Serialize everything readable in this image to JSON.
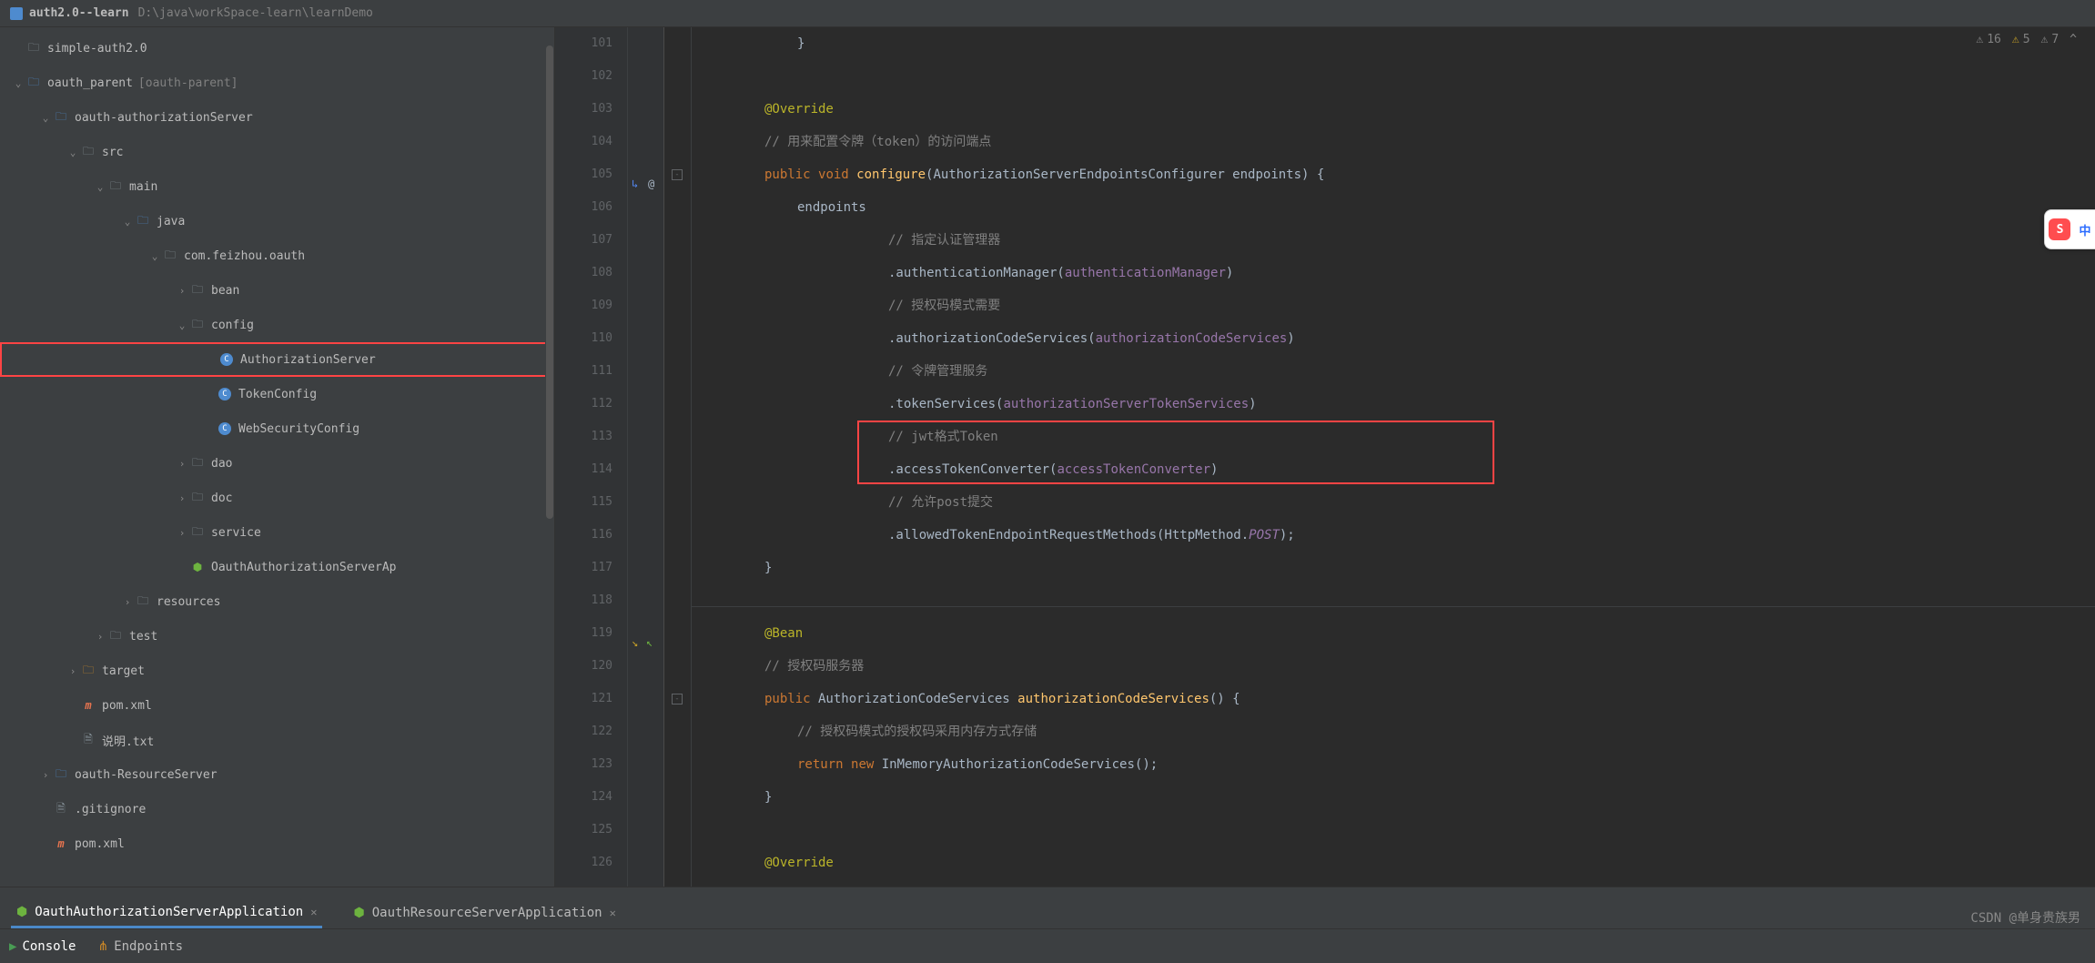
{
  "breadcrumb": {
    "project": "auth2.0--learn",
    "path": "D:\\java\\workSpace-learn\\learnDemo"
  },
  "tree": {
    "items": [
      {
        "indent": 0,
        "arrow": "none",
        "icon": "folder",
        "label": "simple-auth2.0"
      },
      {
        "indent": 0,
        "arrow": "open",
        "icon": "folder-blue",
        "label": "oauth_parent",
        "suffix": "[oauth-parent]"
      },
      {
        "indent": 1,
        "arrow": "open",
        "icon": "folder-blue",
        "label": "oauth-authorizationServer"
      },
      {
        "indent": 2,
        "arrow": "open",
        "icon": "folder",
        "label": "src"
      },
      {
        "indent": 3,
        "arrow": "open",
        "icon": "folder",
        "label": "main"
      },
      {
        "indent": 4,
        "arrow": "open",
        "icon": "folder-blue",
        "label": "java"
      },
      {
        "indent": 5,
        "arrow": "open",
        "icon": "folder",
        "label": "com.feizhou.oauth"
      },
      {
        "indent": 6,
        "arrow": "closed",
        "icon": "folder",
        "label": "bean"
      },
      {
        "indent": 6,
        "arrow": "open",
        "icon": "folder",
        "label": "config"
      },
      {
        "indent": 7,
        "arrow": "none",
        "icon": "class",
        "label": "AuthorizationServer",
        "selected": true
      },
      {
        "indent": 7,
        "arrow": "none",
        "icon": "class",
        "label": "TokenConfig"
      },
      {
        "indent": 7,
        "arrow": "none",
        "icon": "class",
        "label": "WebSecurityConfig"
      },
      {
        "indent": 6,
        "arrow": "closed",
        "icon": "folder",
        "label": "dao"
      },
      {
        "indent": 6,
        "arrow": "closed",
        "icon": "folder",
        "label": "doc"
      },
      {
        "indent": 6,
        "arrow": "closed",
        "icon": "folder",
        "label": "service"
      },
      {
        "indent": 6,
        "arrow": "none",
        "icon": "spring",
        "label": "OauthAuthorizationServerAp"
      },
      {
        "indent": 4,
        "arrow": "closed",
        "icon": "folder",
        "iconClass": "folder",
        "label": "resources"
      },
      {
        "indent": 3,
        "arrow": "closed",
        "icon": "folder",
        "label": "test"
      },
      {
        "indent": 2,
        "arrow": "closed",
        "icon": "folder-orange",
        "label": "target"
      },
      {
        "indent": 2,
        "arrow": "none",
        "icon": "mvn",
        "label": "pom.xml"
      },
      {
        "indent": 2,
        "arrow": "none",
        "icon": "file",
        "label": "说明.txt"
      },
      {
        "indent": 1,
        "arrow": "closed",
        "icon": "folder-blue",
        "label": "oauth-ResourceServer"
      },
      {
        "indent": 1,
        "arrow": "none",
        "icon": "file",
        "label": ".gitignore"
      },
      {
        "indent": 1,
        "arrow": "none",
        "icon": "mvn",
        "label": "pom.xml"
      }
    ]
  },
  "editor_hints": {
    "errors": "16",
    "warnings": "5",
    "weak": "7"
  },
  "gutter_marks": {
    "105": "override",
    "119": "impl-pair"
  },
  "code_lines": [
    {
      "n": 101,
      "html": "<span class='indent2'></span>}"
    },
    {
      "n": 102,
      "html": ""
    },
    {
      "n": 103,
      "html": "<span class='indent1'></span><span class='hl-annotation'>@Override</span>"
    },
    {
      "n": 104,
      "html": "<span class='indent1'></span><span class='hl-comment'>// 用来配置令牌（token）的访问端点</span>"
    },
    {
      "n": 105,
      "html": "<span class='indent1'></span><span class='hl-keyword'>public</span> <span class='hl-keyword'>void</span> <span class='hl-method'>configure</span>(AuthorizationServerEndpointsConfigurer endpoints) {"
    },
    {
      "n": 106,
      "html": "<span class='indent2'></span>endpoints"
    },
    {
      "n": 107,
      "html": "<span class='indent3'></span><span class='hl-comment'>// 指定认证管理器</span>"
    },
    {
      "n": 108,
      "html": "<span class='indent3'></span>.authenticationManager(<span class='hl-field'>authenticationManager</span>)"
    },
    {
      "n": 109,
      "html": "<span class='indent3'></span><span class='hl-comment'>// 授权码模式需要</span>"
    },
    {
      "n": 110,
      "html": "<span class='indent3'></span>.authorizationCodeServices(<span class='hl-field'>authorizationCodeServices</span>)"
    },
    {
      "n": 111,
      "html": "<span class='indent3'></span><span class='hl-comment'>// 令牌管理服务</span>"
    },
    {
      "n": 112,
      "html": "<span class='indent3'></span>.tokenServices(<span class='hl-field'>authorizationServerTokenServices</span>)"
    },
    {
      "n": 113,
      "html": "<span class='indent3'></span><span class='hl-comment'>// jwt格式Token</span>"
    },
    {
      "n": 114,
      "html": "<span class='indent3'></span>.accessTokenConverter(<span class='hl-field'>accessTokenConverter</span>)"
    },
    {
      "n": 115,
      "html": "<span class='indent3'></span><span class='hl-comment'>// 允许post提交</span>"
    },
    {
      "n": 116,
      "html": "<span class='indent3'></span>.allowedTokenEndpointRequestMethods(HttpMethod.<span class='hl-const'>POST</span>);"
    },
    {
      "n": 117,
      "html": "<span class='indent1'></span>}"
    },
    {
      "n": 118,
      "html": ""
    },
    {
      "n": 119,
      "html": "<span class='indent1'></span><span class='hl-annotation'>@Bean</span>"
    },
    {
      "n": 120,
      "html": "<span class='indent1'></span><span class='hl-comment'>// 授权码服务器</span>"
    },
    {
      "n": 121,
      "html": "<span class='indent1'></span><span class='hl-keyword'>public</span> AuthorizationCodeServices <span class='hl-method'>authorizationCodeServices</span>() {"
    },
    {
      "n": 122,
      "html": "<span class='indent2'></span><span class='hl-comment'>// 授权码模式的授权码采用内存方式存储</span>"
    },
    {
      "n": 123,
      "html": "<span class='indent2'></span><span class='hl-keyword'>return</span> <span class='hl-keyword'>new</span> InMemoryAuthorizationCodeServices();"
    },
    {
      "n": 124,
      "html": "<span class='indent1'></span>}"
    },
    {
      "n": 125,
      "html": ""
    },
    {
      "n": 126,
      "html": "<span class='indent1'></span><span class='hl-annotation'>@Override</span>"
    }
  ],
  "run_tabs": [
    {
      "label": "OauthAuthorizationServerApplication",
      "active": true
    },
    {
      "label": "OauthResourceServerApplication",
      "active": false
    }
  ],
  "bottom_tabs": [
    {
      "label": "Console",
      "icon": "play",
      "active": true
    },
    {
      "label": "Endpoints",
      "icon": "endpoints",
      "active": false
    }
  ],
  "watermark": "CSDN @单身贵族男",
  "ime": {
    "logo": "S",
    "lang": "中"
  }
}
